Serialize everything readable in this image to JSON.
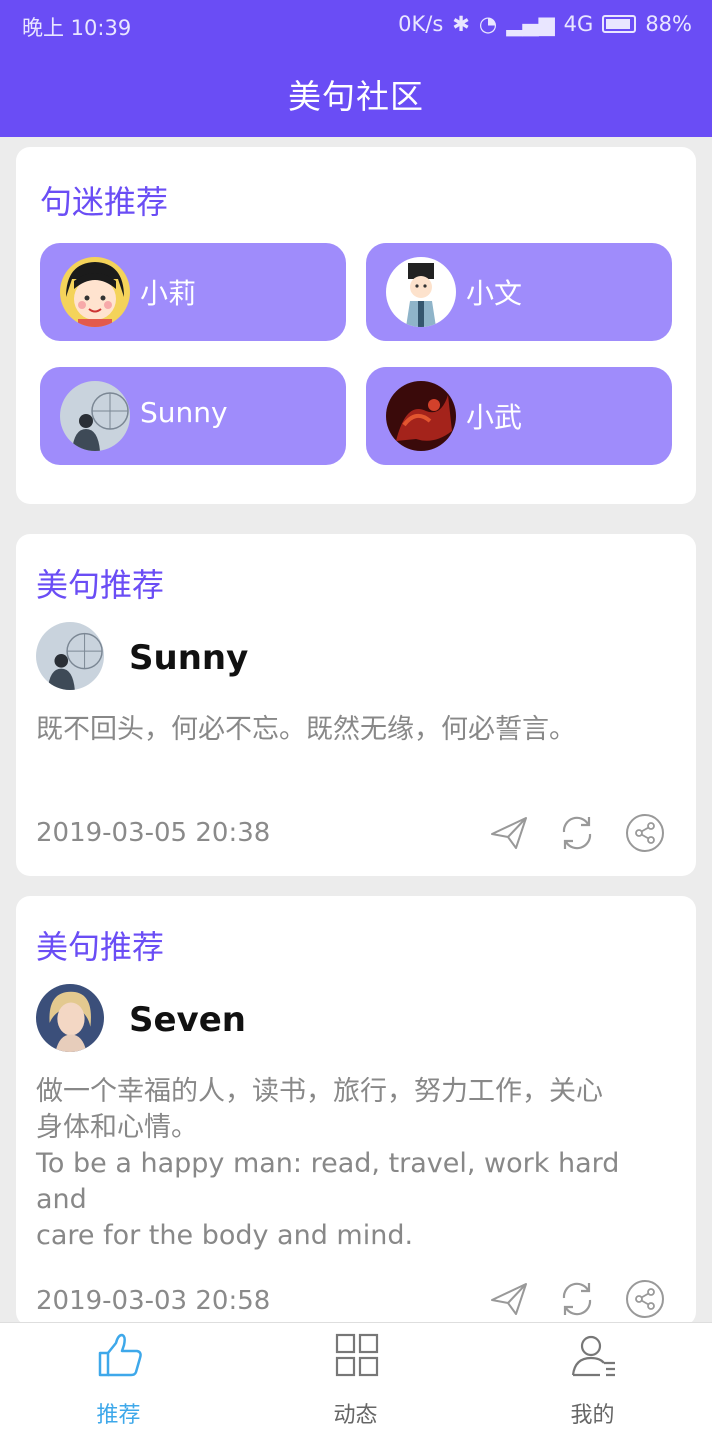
{
  "status_bar": {
    "time": "晚上 10:39",
    "speed": "0K/s",
    "network": "4G",
    "battery": "88%"
  },
  "app_bar": {
    "title": "美句社区"
  },
  "fans_section": {
    "title": "句迷推荐",
    "fans": [
      {
        "name": "小莉"
      },
      {
        "name": "小文"
      },
      {
        "name": "Sunny"
      },
      {
        "name": "小武"
      }
    ]
  },
  "posts": [
    {
      "section_title": "美句推荐",
      "author": "Sunny",
      "text": "既不回头，何必不忘。既然无缘，何必誓言。",
      "date": "2019-03-05 20:38"
    },
    {
      "section_title": "美句推荐",
      "author": "Seven",
      "text_line1": "做一个幸福的人，读书，旅行，努力工作，关心",
      "text_line2": "身体和心情。",
      "text_line3": "To be a happy man: read, travel, work hard and",
      "text_line4": "care for the body and mind.",
      "date": "2019-03-03 20:58"
    }
  ],
  "tab_bar": {
    "tabs": [
      {
        "label": "推荐",
        "icon": "thumbs-up-icon",
        "active": true
      },
      {
        "label": "动态",
        "icon": "grid-icon",
        "active": false
      },
      {
        "label": "我的",
        "icon": "user-list-icon",
        "active": false
      }
    ]
  },
  "colors": {
    "primary": "#6a4df5",
    "fan_button": "#9f8cfb",
    "tab_active": "#3ea8ea",
    "background": "#ececec"
  }
}
